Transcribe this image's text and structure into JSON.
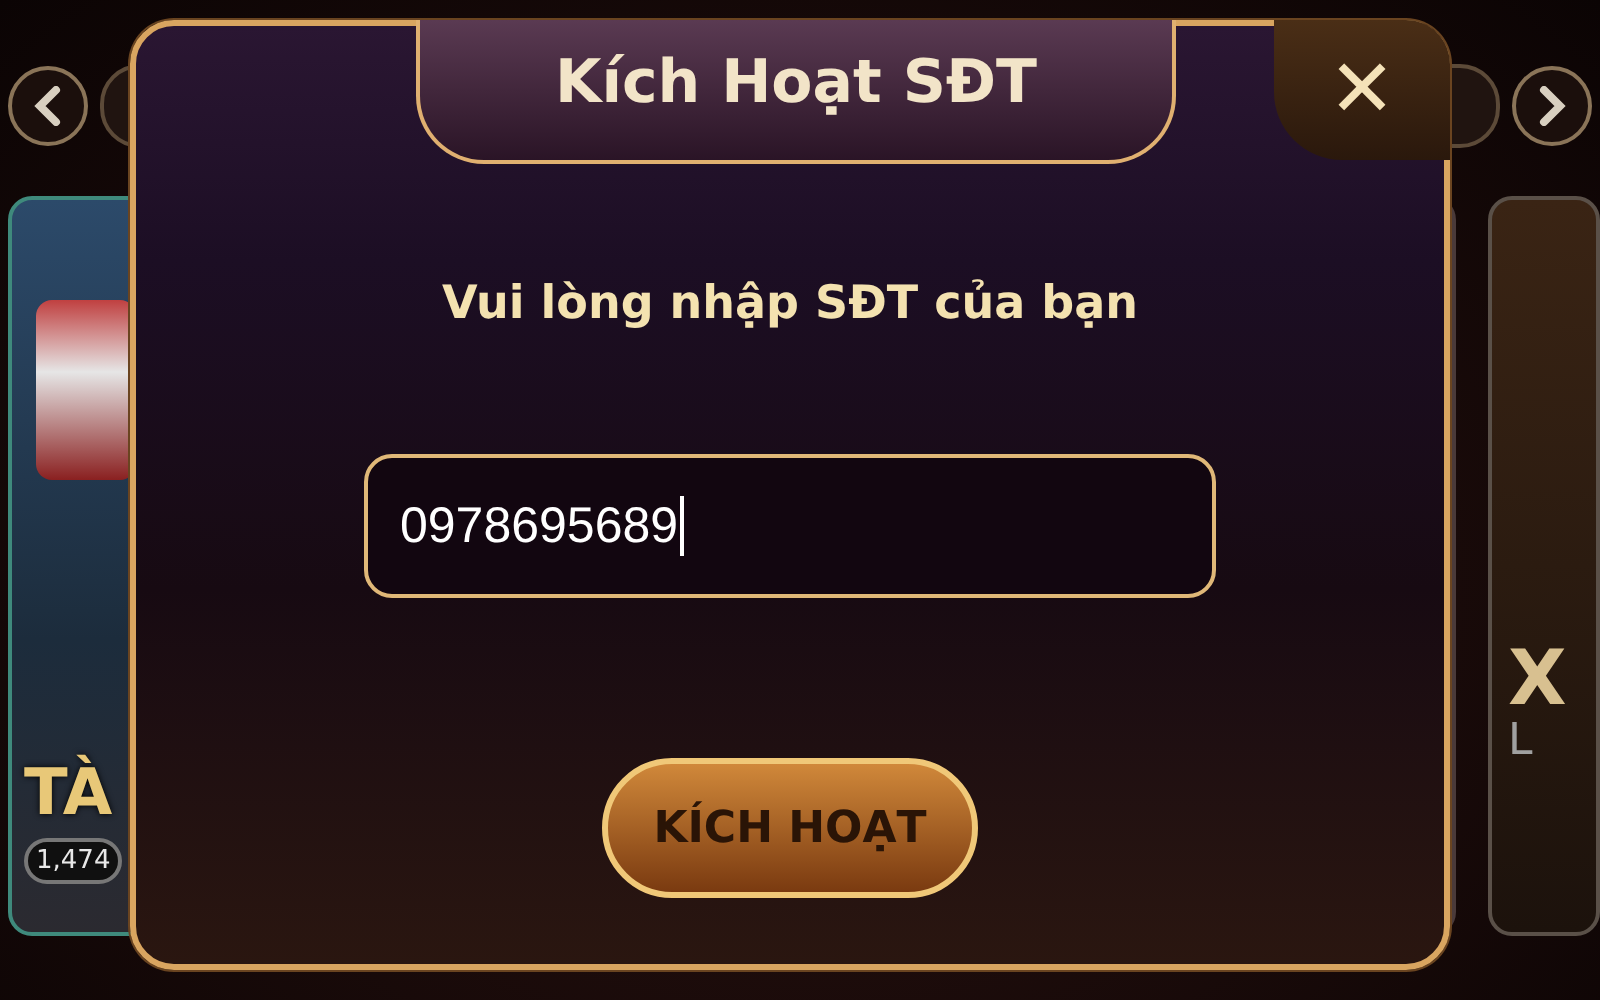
{
  "background": {
    "left_card": {
      "title": "TÀ",
      "count": "1,474"
    },
    "right_card": {
      "title": "X",
      "subtitle": "L"
    }
  },
  "dialog": {
    "title": "Kích Hoạt SĐT",
    "close": "✕",
    "prompt": "Vui lòng nhập SĐT của bạn",
    "phone_field": {
      "value": "0978695689"
    },
    "buttons": [
      "KÍCH HOẠT"
    ]
  }
}
